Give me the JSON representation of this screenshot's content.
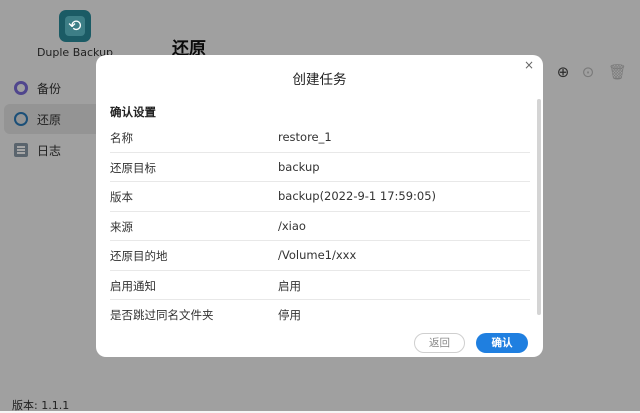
{
  "app": {
    "name": "Duple Backup",
    "version": "版本: 1.1.1",
    "page_title": "还原",
    "nav": [
      {
        "label": "备份",
        "icon": "backup-icon"
      },
      {
        "label": "还原",
        "icon": "restore-icon"
      },
      {
        "label": "日志",
        "icon": "log-icon"
      }
    ],
    "toolbar_icons": [
      "add-icon",
      "run-icon",
      "delete-icon"
    ],
    "accent_color": "#1f7fe0"
  },
  "modal": {
    "title": "创建任务",
    "section_title": "确认设置",
    "rows": [
      {
        "key": "名称",
        "value": "restore_1"
      },
      {
        "key": "还原目标",
        "value": "backup"
      },
      {
        "key": "版本",
        "value": "backup(2022-9-1 17:59:05)"
      },
      {
        "key": "来源",
        "value": "/xiao"
      },
      {
        "key": "还原目的地",
        "value": "/Volume1/xxx"
      },
      {
        "key": "启用通知",
        "value": "启用"
      },
      {
        "key": "是否跳过同名文件夹",
        "value": "停用"
      }
    ],
    "back_label": "返回",
    "ok_label": "确认",
    "close_glyph": "×"
  }
}
